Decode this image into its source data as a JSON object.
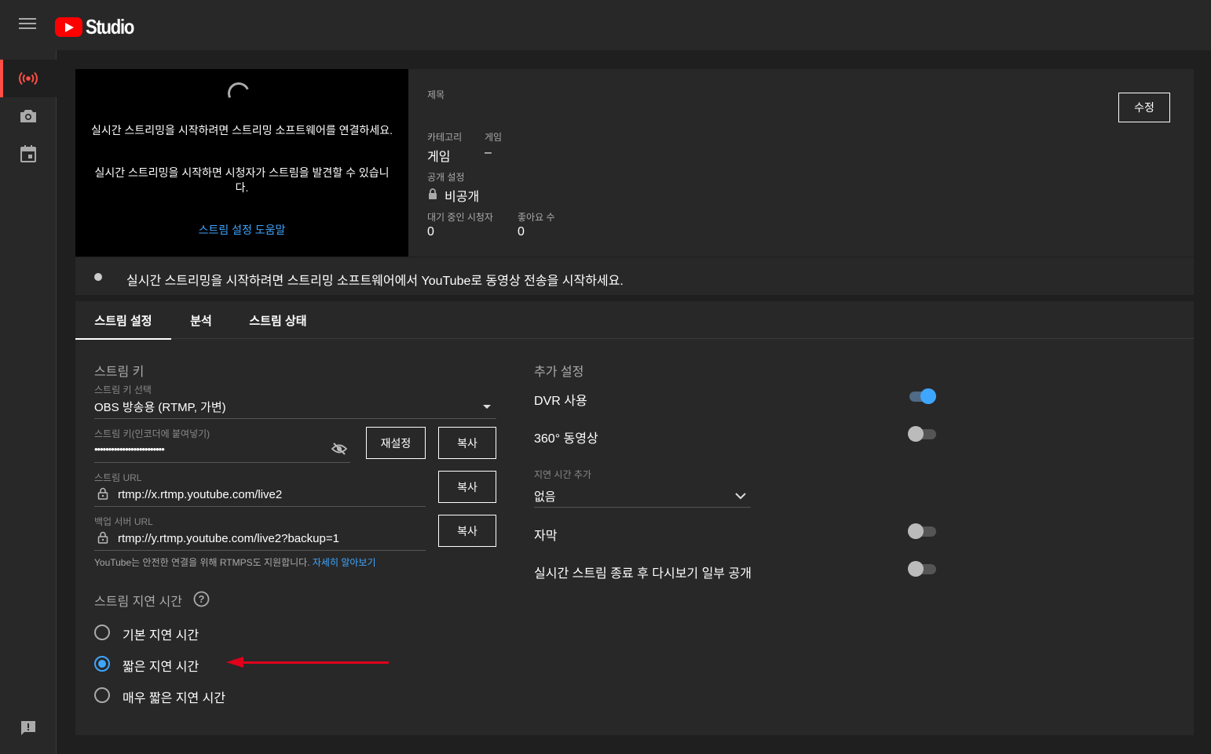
{
  "app": {
    "title": "Studio"
  },
  "sidebar": {
    "items": [
      {
        "icon": "live-broadcast-icon",
        "active": true
      },
      {
        "icon": "camera-icon",
        "active": false
      },
      {
        "icon": "calendar-icon",
        "active": false
      }
    ],
    "feedback_icon": "feedback-icon"
  },
  "preview": {
    "message1": "실시간 스트리밍을 시작하려면 스트리밍 소프트웨어를 연결하세요.",
    "message2": "실시간 스트리밍을 시작하면 시청자가 스트림을 발견할 수 있습니다.",
    "help_link": "스트림 설정 도움말"
  },
  "info": {
    "title_label": "제목",
    "category_label": "카테고리",
    "category_value": "게임",
    "game_label": "게임",
    "game_value": "–",
    "visibility_label": "공개 설정",
    "visibility_value": "비공개",
    "waiting_label": "대기 중인 시청자",
    "waiting_value": "0",
    "likes_label": "좋아요 수",
    "likes_value": "0",
    "edit_button": "수정"
  },
  "status": {
    "text": "실시간 스트리밍을 시작하려면 스트리밍 소프트웨어에서 YouTube로 동영상 전송을 시작하세요."
  },
  "tabs": [
    {
      "label": "스트림 설정",
      "active": true
    },
    {
      "label": "분석",
      "active": false
    },
    {
      "label": "스트림 상태",
      "active": false
    }
  ],
  "stream_key": {
    "section_title": "스트림 키",
    "select_label": "스트림 키 선택",
    "select_value": "OBS 방송용 (RTMP, 가변)",
    "key_label": "스트림 키(인코더에 붙여넣기)",
    "key_value": "•••••••••••••••••••••••••",
    "reset_button": "재설정",
    "copy_button": "복사",
    "url_label": "스트림 URL",
    "url_value": "rtmp://x.rtmp.youtube.com/live2",
    "backup_label": "백업 서버 URL",
    "backup_value": "rtmp://y.rtmp.youtube.com/live2?backup=1",
    "rtmps_note": "YouTube는 안전한 연결을 위해 RTMPS도 지원합니다.",
    "rtmps_link": "자세히 알아보기"
  },
  "latency": {
    "title": "스트림 지연 시간",
    "options": [
      {
        "label": "기본 지연 시간",
        "checked": false
      },
      {
        "label": "짧은 지연 시간",
        "checked": true
      },
      {
        "label": "매우 짧은 지연 시간",
        "checked": false
      }
    ]
  },
  "additional": {
    "title": "추가 설정",
    "dvr_label": "DVR 사용",
    "dvr_on": true,
    "video360_label": "360° 동영상",
    "video360_on": false,
    "delay_label": "지연 시간 추가",
    "delay_value": "없음",
    "captions_label": "자막",
    "captions_on": false,
    "replay_label": "실시간 스트림 종료 후 다시보기 일부 공개",
    "replay_on": false
  },
  "annotation": {
    "color": "#e0001b"
  }
}
